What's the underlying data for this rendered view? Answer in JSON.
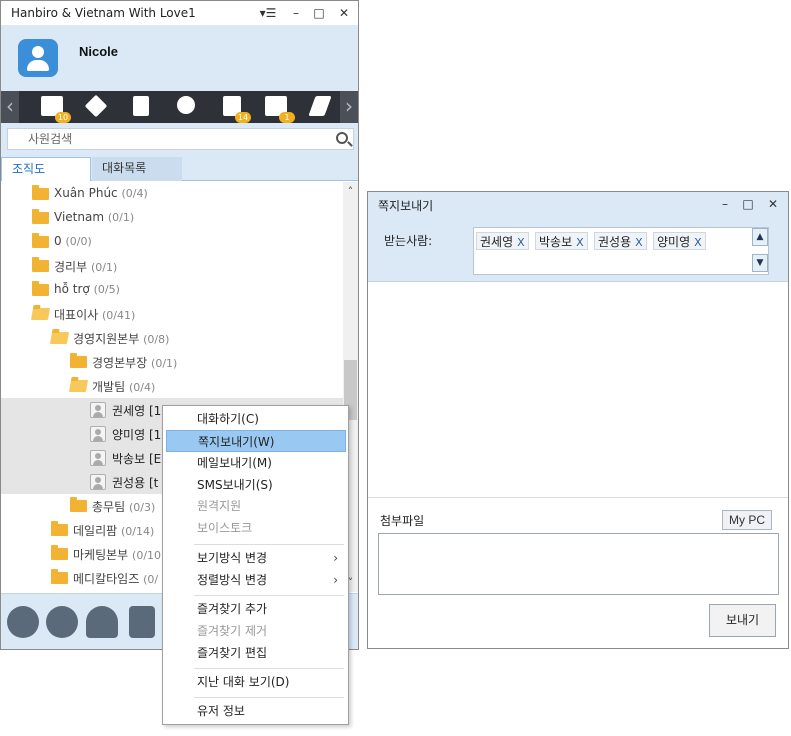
{
  "main_window": {
    "title": "Hanbiro & Vietnam With Love1",
    "controls": {
      "menu": "▾☰",
      "minimize": "–",
      "maximize": "□",
      "close": "✕"
    },
    "username": "Nicole"
  },
  "toolbar": {
    "left_arrow": "‹",
    "right_arrow": "›",
    "icons": [
      {
        "name": "mail-icon",
        "badge": "10"
      },
      {
        "name": "puzzle-icon",
        "badge": ""
      },
      {
        "name": "clipboard-icon",
        "badge": ""
      },
      {
        "name": "tools-icon",
        "badge": ""
      },
      {
        "name": "document-edit-icon",
        "badge": "14"
      },
      {
        "name": "text-note-icon",
        "badge": "1"
      },
      {
        "name": "user-edit-icon",
        "badge": ""
      }
    ]
  },
  "search": {
    "placeholder": "사원검색"
  },
  "tabs": {
    "org": "조직도",
    "chat_list": "대화목록"
  },
  "tree": [
    {
      "label": "Xuân Phúc",
      "count": "(0/4)"
    },
    {
      "label": "Vietnam",
      "count": "(0/1)"
    },
    {
      "label": "0",
      "count": "(0/0)"
    },
    {
      "label": "경리부",
      "count": "(0/1)"
    },
    {
      "label": "hỗ trợ",
      "count": "(0/5)"
    },
    {
      "label": "대표이사",
      "count": "(0/41)"
    },
    {
      "label": "경영지원본부",
      "count": "(0/8)"
    },
    {
      "label": "경영본부장",
      "count": "(0/1)"
    },
    {
      "label": "개발팀",
      "count": "(0/4)"
    },
    {
      "label": "권세영",
      "count": "[1"
    },
    {
      "label": "양미영",
      "count": "[1"
    },
    {
      "label": "박송보",
      "count": "[E"
    },
    {
      "label": "권성용",
      "count": "[t"
    },
    {
      "label": "총무팀",
      "count": "(0/3)"
    },
    {
      "label": "데일리팜",
      "count": "(0/14)"
    },
    {
      "label": "마케팅본부",
      "count": "(0/10"
    },
    {
      "label": "메디칼타임즈",
      "count": "(0/"
    }
  ],
  "scrollbar": {
    "up": "˄",
    "down": "˅"
  },
  "bottom_icons": [
    "contacts-icon",
    "chat-bubble-icon",
    "cloud-save-icon",
    "sms-icon"
  ],
  "context_menu": {
    "items": [
      {
        "label": "대화하기(C)"
      },
      {
        "label": "쪽지보내기(W)"
      },
      {
        "label": "메일보내기(M)"
      },
      {
        "label": "SMS보내기(S)"
      },
      {
        "label": "원격지원"
      },
      {
        "label": "보이스토크"
      },
      {
        "label": "보기방식 변경",
        "arrow": "›"
      },
      {
        "label": "정렬방식 변경",
        "arrow": "›"
      },
      {
        "label": "즐겨찾기 추가"
      },
      {
        "label": "즐겨찾기 제거"
      },
      {
        "label": "즐겨찾기 편집"
      },
      {
        "label": "지난 대화 보기(D)"
      },
      {
        "label": "유저 정보"
      }
    ]
  },
  "note_window": {
    "title": "쪽지보내기",
    "controls": {
      "minimize": "–",
      "maximize": "□",
      "close": "✕"
    },
    "recipients_label": "받는사람:",
    "recipients": [
      {
        "name": "권세영",
        "remove": "X"
      },
      {
        "name": "박송보",
        "remove": "X"
      },
      {
        "name": "권성용",
        "remove": "X"
      },
      {
        "name": "양미영",
        "remove": "X"
      }
    ],
    "recipient_scroll": {
      "up": "▲",
      "down": "▼"
    },
    "attachment_label": "첨부파일",
    "my_pc_button": "My PC",
    "send_button": "보내기"
  }
}
